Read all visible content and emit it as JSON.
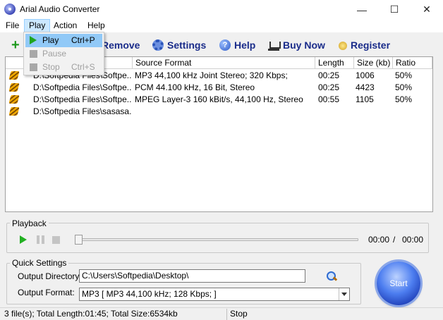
{
  "window": {
    "title": "Arial Audio Converter"
  },
  "menu": [
    "File",
    "Play",
    "Action",
    "Help"
  ],
  "play_menu": {
    "items": [
      {
        "label": "Play",
        "shortcut": "Ctrl+P"
      },
      {
        "label": "Pause",
        "shortcut": ""
      },
      {
        "label": "Stop",
        "shortcut": "Ctrl+S"
      }
    ]
  },
  "toolbar": {
    "remove_label": "Remove",
    "settings_label": "Settings",
    "help_label": "Help",
    "buy_label": "Buy Now",
    "register_label": "Register"
  },
  "filelist": {
    "columns": [
      "Source Format",
      "Length",
      "Size (kb)",
      "Ratio"
    ],
    "rows": [
      {
        "file": "D:\\Softpedia Files\\Softpe...",
        "format": "MP3  44,100 kHz Joint Stereo;  320 Kbps;",
        "length": "00:25",
        "size": "1006",
        "ratio": "50%"
      },
      {
        "file": "D:\\Softpedia Files\\Softpe...",
        "format": "PCM 44.100 kHz, 16 Bit, Stereo",
        "length": "00:25",
        "size": "4423",
        "ratio": "50%"
      },
      {
        "file": "D:\\Softpedia Files\\Softpe...",
        "format": "MPEG Layer-3 160 kBit/s, 44,100 Hz, Stereo",
        "length": "00:55",
        "size": "1105",
        "ratio": "50%"
      },
      {
        "file": "D:\\Softpedia Files\\sasasa...",
        "format": "",
        "length": "",
        "size": "",
        "ratio": ""
      }
    ]
  },
  "playback": {
    "label": "Playback",
    "time_current": "00:00",
    "time_separator": "/",
    "time_total": "00:00",
    "position": 0
  },
  "quick_settings": {
    "label": "Quick Settings",
    "output_dir_label": "Output Directory",
    "output_dir_value": "C:\\Users\\Softpedia\\Desktop\\",
    "output_format_label": "Output Format:",
    "output_format_value": "MP3  [ MP3 44,100 kHz;  128 Kbps;  ]"
  },
  "start_label": "Start",
  "status": {
    "summary": "3 file(s); Total Length:01:45; Total Size:6534kb",
    "state": "Stop"
  },
  "colors": {
    "accent": "#1a2c8a",
    "menu_highlight": "#91c9f7",
    "start": "#4d7ef0"
  }
}
